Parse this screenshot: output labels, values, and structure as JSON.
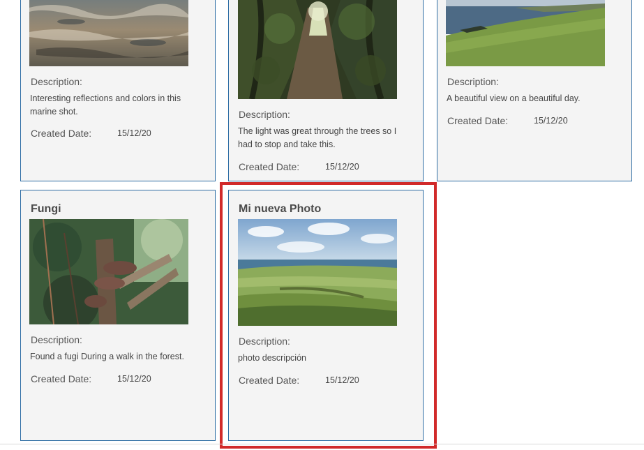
{
  "labels": {
    "description": "Description:",
    "created_date": "Created Date:"
  },
  "cards": [
    {
      "title": "",
      "description": "Interesting reflections and colors in this marine shot.",
      "created_date": "15/12/20"
    },
    {
      "title": "",
      "description": "The light was great through the trees so I had to stop and take this.",
      "created_date": "15/12/20"
    },
    {
      "title": "",
      "description": "A beautiful view on a beautiful day.",
      "created_date": "15/12/20"
    },
    {
      "title": "Fungi",
      "description": "Found a fugi During a walk in the forest.",
      "created_date": "15/12/20"
    },
    {
      "title": "Mi nueva Photo",
      "description": "photo descripción",
      "created_date": "15/12/20",
      "highlighted": true
    }
  ],
  "colors": {
    "card_border": "#2e6da4",
    "card_background": "#f4f4f4",
    "highlight": "#d12a2a"
  }
}
